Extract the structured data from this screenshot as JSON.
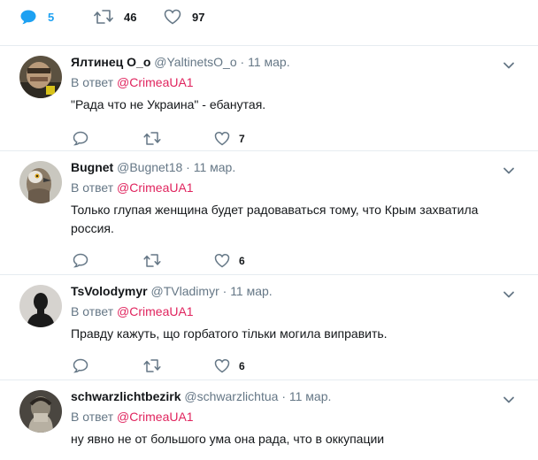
{
  "top_actions": {
    "replies": "5",
    "retweets": "46",
    "likes": "97",
    "reply_color": "#1da1f2"
  },
  "tweets": [
    {
      "name": "Ялтинец O_o",
      "handle": "@YaltinetsO_o",
      "time": "11 мар.",
      "reply_prefix": "В ответ",
      "reply_mention": "@CrimeaUA1",
      "text": "\"Рада что не Украина\" - ебанутая.",
      "replies": "",
      "retweets": "",
      "likes": "7"
    },
    {
      "name": "Bugnet",
      "handle": "@Bugnet18",
      "time": "11 мар.",
      "reply_prefix": "В ответ",
      "reply_mention": "@CrimeaUA1",
      "text": "Только глупая женщина будет радоваваться тому, что Крым захватила россия.",
      "replies": "",
      "retweets": "",
      "likes": "6"
    },
    {
      "name": "TsVolodymyr",
      "handle": "@TVladimyr",
      "time": "11 мар.",
      "reply_prefix": "В ответ",
      "reply_mention": "@CrimeaUA1",
      "text": "Правду кажуть, що горбатого тільки могила виправить.",
      "replies": "",
      "retweets": "",
      "likes": "6"
    },
    {
      "name": "schwarzlichtbezirk",
      "handle": "@schwarzlichtua",
      "time": "11 мар.",
      "reply_prefix": "В ответ",
      "reply_mention": "@CrimeaUA1",
      "text": "ну явно не от большого ума она рада, что в оккупации"
    }
  ],
  "separator": "·",
  "colors": {
    "mention": "#e0245e",
    "secondary_text": "#657786",
    "icon_gray": "#657786",
    "reply_blue": "#1da1f2",
    "divider": "#e6ecf0"
  }
}
